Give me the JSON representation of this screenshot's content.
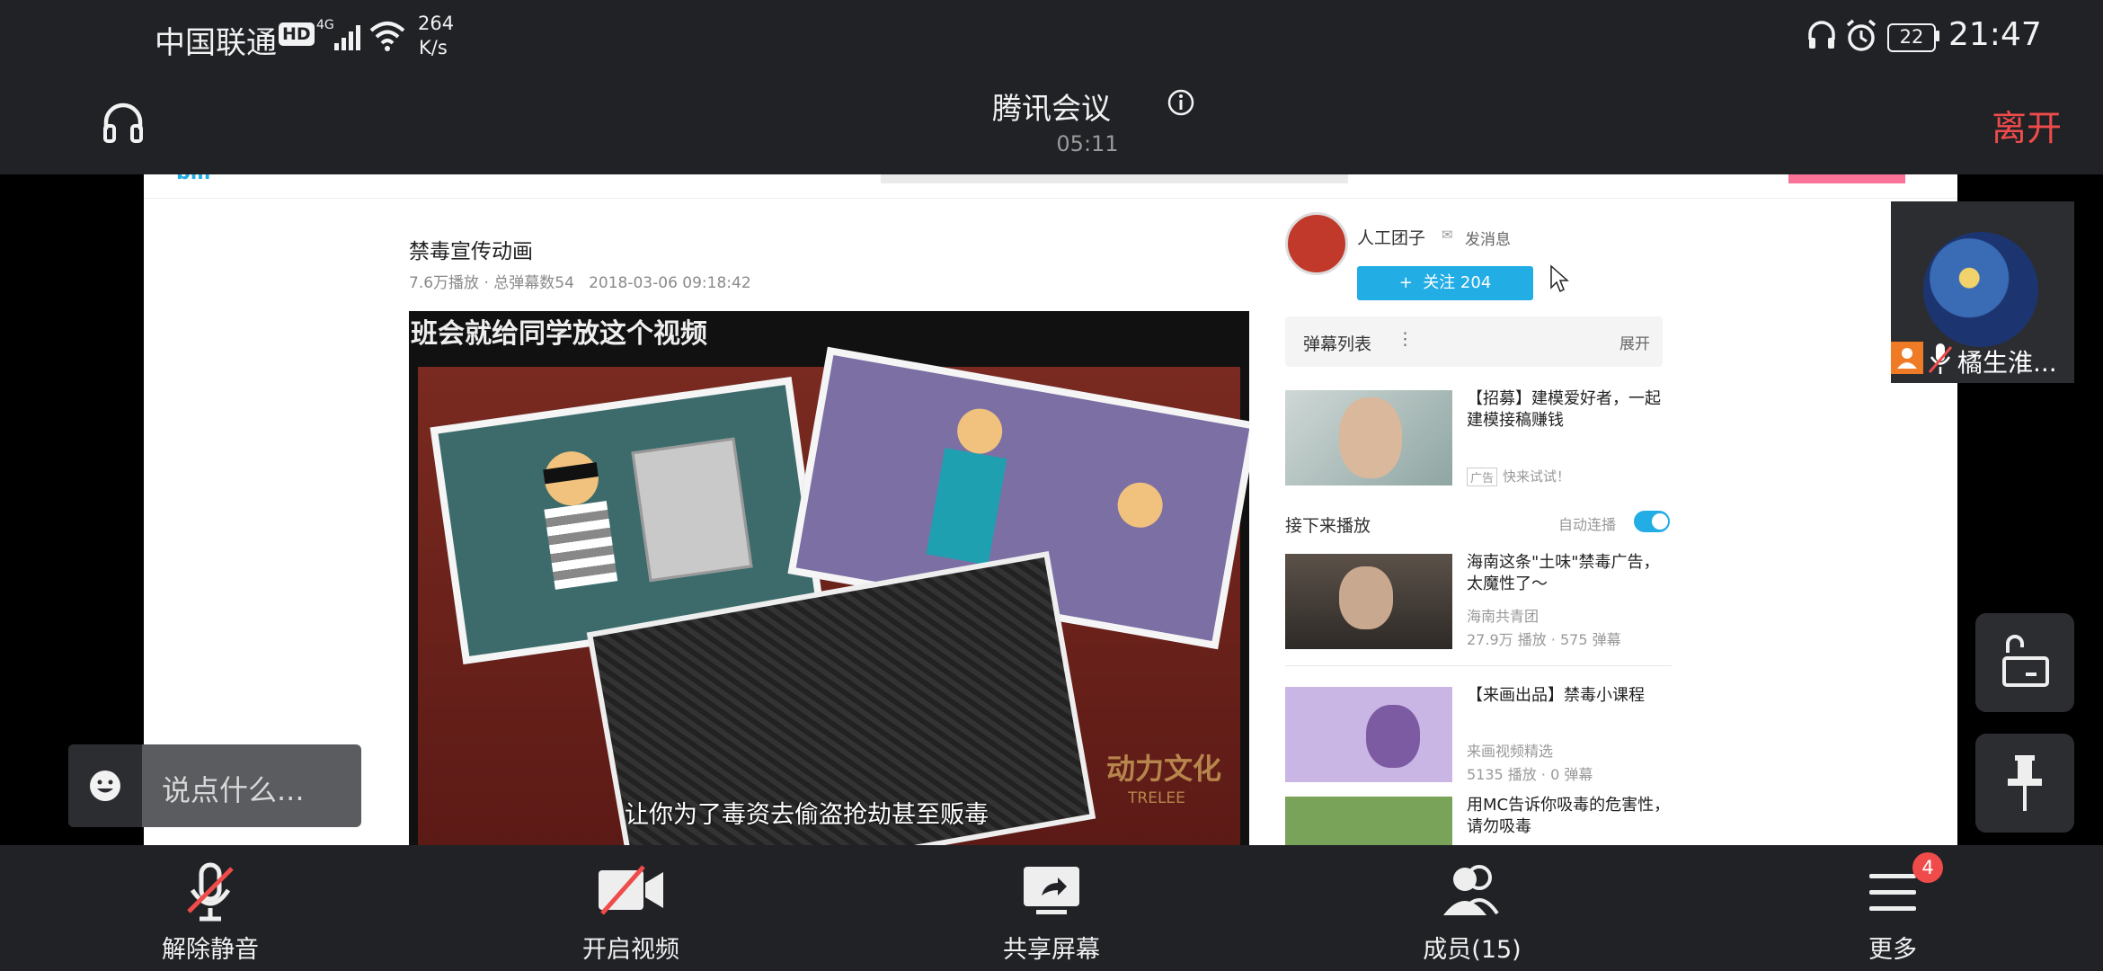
{
  "status_bar": {
    "carrier": "中国联通",
    "hd": "HD",
    "network": "4G",
    "speed_value": "264",
    "speed_unit": "K/s",
    "battery": "22",
    "time": "21:47"
  },
  "meeting": {
    "title": "腾讯会议",
    "duration": "05:11",
    "leave_label": "离开"
  },
  "video_page": {
    "video_title": "禁毒宣传动画",
    "meta": "7.6万播放 · 总弹幕数54   2018-03-06 09:18:42",
    "frame_caption_top": "班会就给同学放这个视频",
    "frame_subtitle": "让你为了毒资去偷盗抢劫甚至贩毒",
    "frame_watermark": "动力文化",
    "frame_watermark_sub": "TRELEE",
    "uploader": "人工团子",
    "send_message": "发消息",
    "follow_label": "+  关注 204",
    "danmaku_list": "弹幕列表",
    "expand": "展开",
    "ad_title": "【招募】建模爱好者，一起建模接稿赚钱",
    "ad_tag": "广告",
    "ad_sub": "快来试试！",
    "next_up": "接下来播放",
    "autoplay": "自动连播",
    "recommendations": [
      {
        "title": "海南这条\"土味\"禁毒广告，太魔性了～",
        "author": "海南共青团",
        "stats": "27.9万 播放 · 575 弹幕"
      },
      {
        "title": "【来画出品】禁毒小课程",
        "author": "来画视频精选",
        "stats": "5135 播放 · 0 弹幕"
      },
      {
        "title": "用MC告诉你吸毒的危害性，请勿吸毒",
        "author": "",
        "stats": ""
      }
    ]
  },
  "participant": {
    "name": "橘生淮..."
  },
  "chat": {
    "placeholder": "说点什么..."
  },
  "toolbar": {
    "unmute": "解除静音",
    "video": "开启视频",
    "share": "共享屏幕",
    "members": "成员(15)",
    "more": "更多",
    "more_badge": "4"
  },
  "colors": {
    "bar_bg": "#202226",
    "leave_red": "#f04b4b",
    "follow_blue": "#23ade5",
    "badge_red": "#f04b4b"
  }
}
